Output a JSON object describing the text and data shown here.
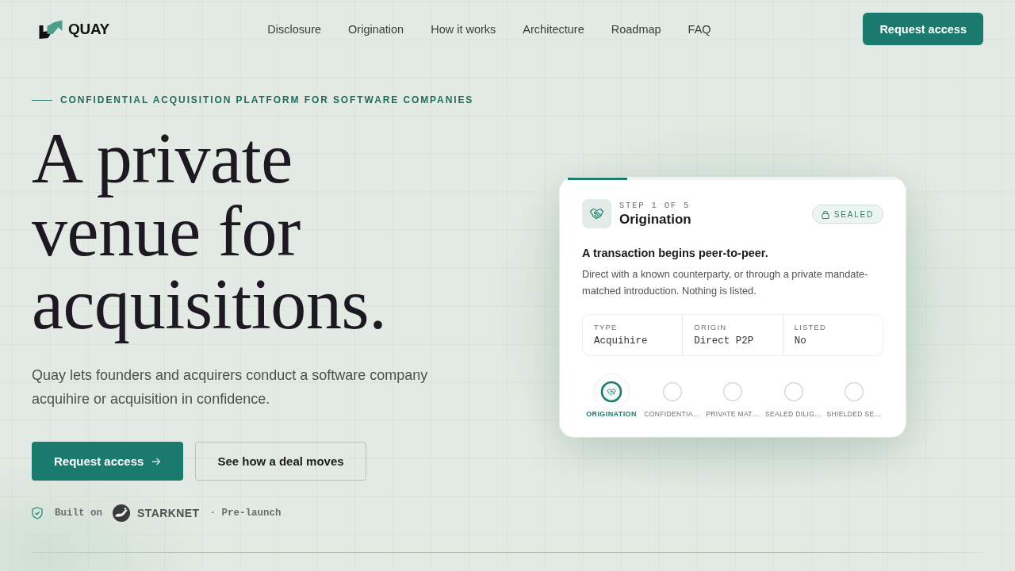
{
  "header": {
    "logo": "QUAY",
    "nav": [
      "Disclosure",
      "Origination",
      "How it works",
      "Architecture",
      "Roadmap",
      "FAQ"
    ],
    "cta": "Request access"
  },
  "hero": {
    "eyebrow": "CONFIDENTIAL ACQUISITION PLATFORM FOR SOFTWARE COMPANIES",
    "title": "A private venue for acquisitions.",
    "lede": "Quay lets founders and acquirers conduct a software company acquihire or acquisition in confidence.",
    "buttons": [
      {
        "label": "Request access",
        "kind": "primary"
      },
      {
        "label": "See how a deal moves",
        "kind": "secondary"
      }
    ],
    "built_on": {
      "prefix": "Built on",
      "brand": "STARKNET",
      "suffix": "· Pre-launch"
    }
  },
  "card": {
    "progress": {
      "level": 0.18
    },
    "step_counter": "STEP 1 OF 5",
    "title": "Origination",
    "badge": "SEALED",
    "heading": "A transaction begins peer-to-peer.",
    "description": "Direct with a known counterparty, or through a private mandate-matched introduction. Nothing is listed.",
    "facts": [
      {
        "label": "TYPE",
        "value": "Acquihire"
      },
      {
        "label": "ORIGIN",
        "value": "Direct P2P"
      },
      {
        "label": "LISTED",
        "value": "No"
      }
    ],
    "steps": [
      {
        "label": "ORIGINATION",
        "selected": true
      },
      {
        "label": "CONFIDENTIA…",
        "selected": false
      },
      {
        "label": "PRIVATE MAT…",
        "selected": false
      },
      {
        "label": "SEALED DILIG…",
        "selected": false
      },
      {
        "label": "SHIELDED SE…",
        "selected": false
      }
    ]
  }
}
